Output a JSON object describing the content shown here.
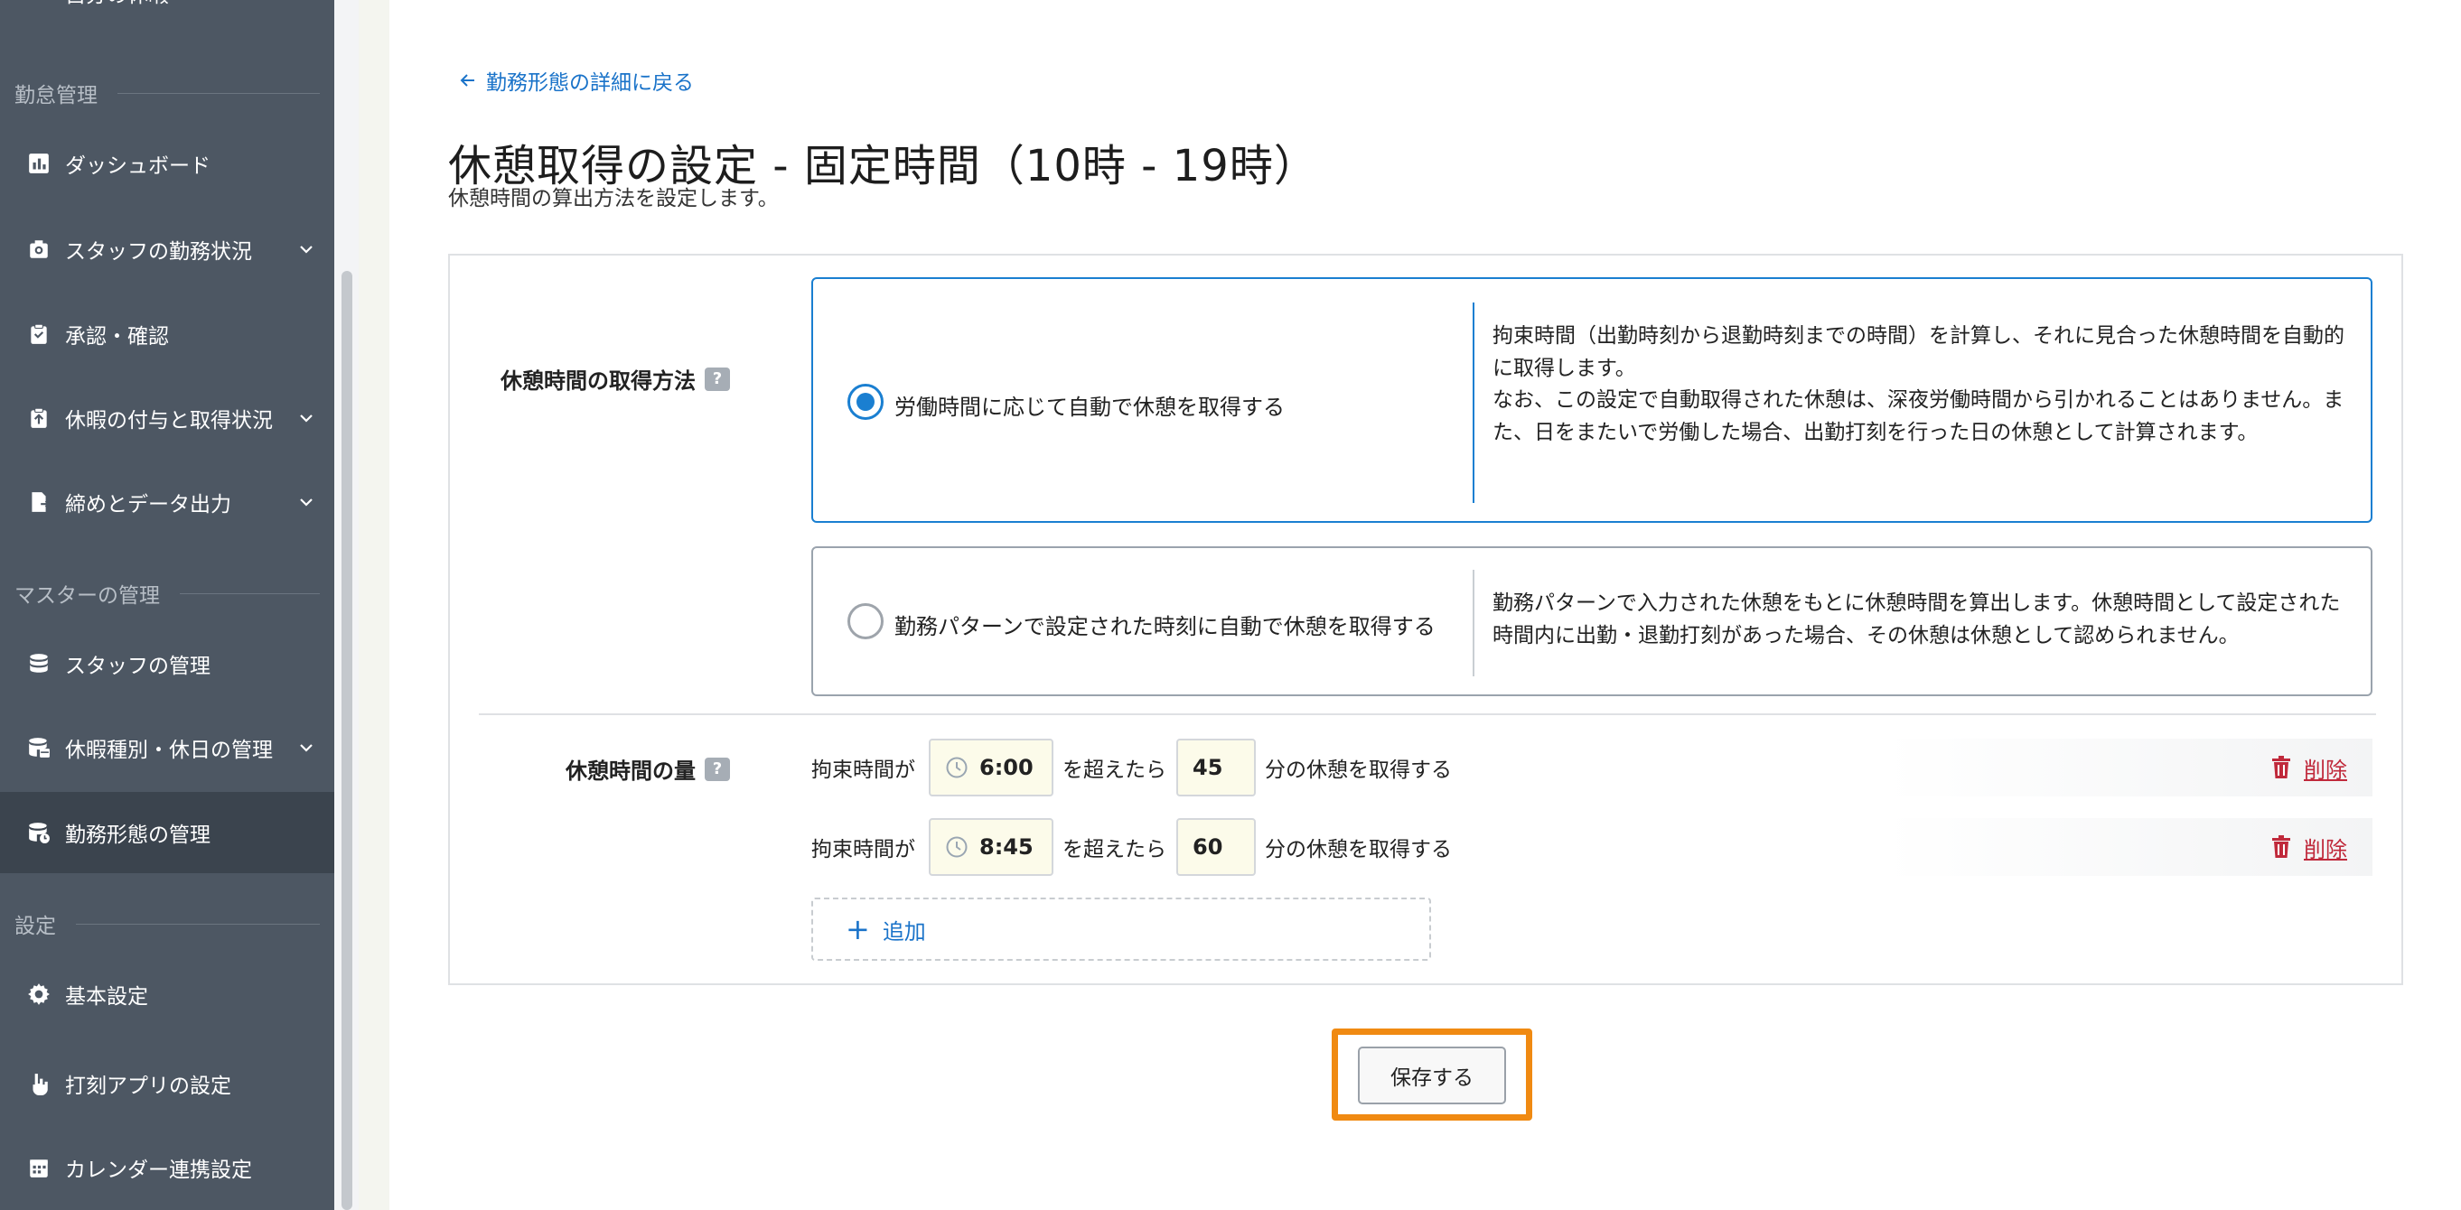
{
  "sidebar": {
    "top_item": "自分の休暇",
    "sections": [
      {
        "title": "勤怠管理"
      },
      {
        "title": "マスターの管理"
      },
      {
        "title": "設定"
      }
    ],
    "items": [
      {
        "label": "ダッシュボード",
        "icon": "chart-icon"
      },
      {
        "label": "スタッフの勤務状況",
        "icon": "camera-icon",
        "expandable": true
      },
      {
        "label": "承認・確認",
        "icon": "clipboard-icon"
      },
      {
        "label": "休暇の付与と取得状況",
        "icon": "clipboard-upload-icon",
        "expandable": true
      },
      {
        "label": "締めとデータ出力",
        "icon": "document-export-icon",
        "expandable": true
      },
      {
        "label": "スタッフの管理",
        "icon": "database-icon"
      },
      {
        "label": "休暇種別・休日の管理",
        "icon": "database-calendar-icon",
        "expandable": true
      },
      {
        "label": "勤務形態の管理",
        "icon": "database-clock-icon",
        "active": true
      },
      {
        "label": "基本設定",
        "icon": "gear-icon"
      },
      {
        "label": "打刻アプリの設定",
        "icon": "hand-tap-icon"
      },
      {
        "label": "カレンダー連携設定",
        "icon": "calendar-icon"
      }
    ]
  },
  "main": {
    "back_link": "勤務形態の詳細に戻る",
    "title": "休憩取得の設定 - 固定時間（10時 - 19時）",
    "description": "休憩時間の算出方法を設定します。",
    "method": {
      "label": "休憩時間の取得方法",
      "options": [
        {
          "label": "労働時間に応じて自動で休憩を取得する",
          "selected": true,
          "description": "拘束時間（出勤時刻から退勤時刻までの時間）を計算し、それに見合った休憩時間を自動的に取得します。\nなお、この設定で自動取得された休憩は、深夜労働時間から引かれることはありません。また、日をまたいで労働した場合、出勤打刻を行った日の休憩として計算されます。"
        },
        {
          "label": "勤務パターンで設定された時刻に自動で休憩を取得する",
          "selected": false,
          "description": "勤務パターンで入力された休憩をもとに休憩時間を算出します。休憩時間として設定された時間内に出勤・退勤打刻があった場合、その休憩は休憩として認められません。"
        }
      ]
    },
    "amount": {
      "label": "休憩時間の量",
      "prefix": "拘束時間が",
      "middle": "を超えたら",
      "suffix": "分の休憩を取得する",
      "rows": [
        {
          "time": "6:00",
          "minutes": "45",
          "delete_label": "削除"
        },
        {
          "time": "8:45",
          "minutes": "60",
          "delete_label": "削除"
        }
      ],
      "add_label": "追加"
    },
    "save_label": "保存する"
  },
  "colors": {
    "sidebar_bg": "#4d5763",
    "accent": "#1a7fd1",
    "danger": "#c0293b",
    "highlight": "#f08a12"
  }
}
